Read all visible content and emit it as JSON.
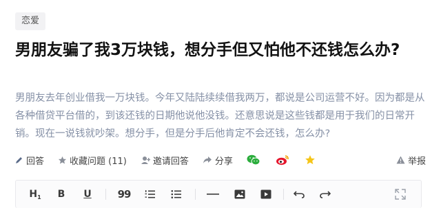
{
  "tag": "恋爱",
  "title": "男朋友骗了我3万块钱，想分手但又怕他不还钱怎么办?",
  "description": "男朋友去年创业借我一万块钱。今年又陆陆续续借我两万，都说是公司运营不好。因为都是从各种借贷平台借的，到该还钱的日期他说他没钱。还意思说是这些钱都是用于我们的日常开销。现在一说钱就吵架。想分手，但是分手后他肯定不会还钱，怎么办?",
  "actions": {
    "answer": "回答",
    "collect": "收藏问题 (11)",
    "invite": "邀请回答",
    "share": "分享",
    "report": "举报"
  },
  "toolbar": {
    "heading": "H",
    "heading_sub": "1",
    "bold": "B",
    "underline": "U",
    "quote": "99"
  },
  "colors": {
    "wechat": "#2bad3c",
    "weibo": "#e6162d",
    "star": "#f5c518",
    "muted": "#8590a6"
  }
}
